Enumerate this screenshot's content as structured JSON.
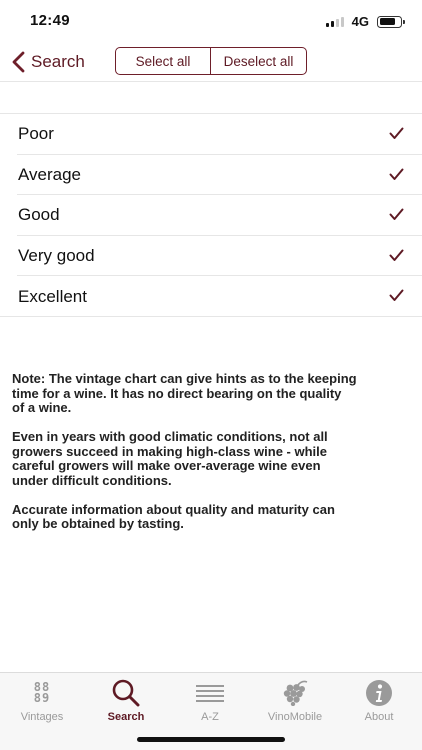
{
  "status": {
    "time": "12:49",
    "network": "4G"
  },
  "nav": {
    "back_label": "Search",
    "select_all": "Select all",
    "deselect_all": "Deselect all"
  },
  "quality_options": [
    {
      "label": "Poor",
      "checked": true
    },
    {
      "label": "Average",
      "checked": true
    },
    {
      "label": "Good",
      "checked": true
    },
    {
      "label": "Very good",
      "checked": true
    },
    {
      "label": "Excellent",
      "checked": true
    }
  ],
  "notes": [
    "Note: The vintage chart can give hints as to the keeping time for a wine. It has no direct bearing on the quality of a wine.",
    "Even in years with good climatic conditions, not all growers succeed in making high-class wine - while careful growers will make over-average wine even under difficult conditions.",
    "Accurate information about quality and maturity can only be obtained by tasting."
  ],
  "tabs": [
    {
      "label": "Vintages",
      "icon": "vintages-icon",
      "icon_text": "88\n89",
      "active": false
    },
    {
      "label": "Search",
      "icon": "search-icon",
      "active": true
    },
    {
      "label": "A-Z",
      "icon": "list-icon",
      "active": false
    },
    {
      "label": "VinoMobile",
      "icon": "grapes-icon",
      "active": false
    },
    {
      "label": "About",
      "icon": "info-icon",
      "active": false
    }
  ],
  "colors": {
    "accent": "#5e1a24",
    "inactive": "#9a9a9a"
  }
}
